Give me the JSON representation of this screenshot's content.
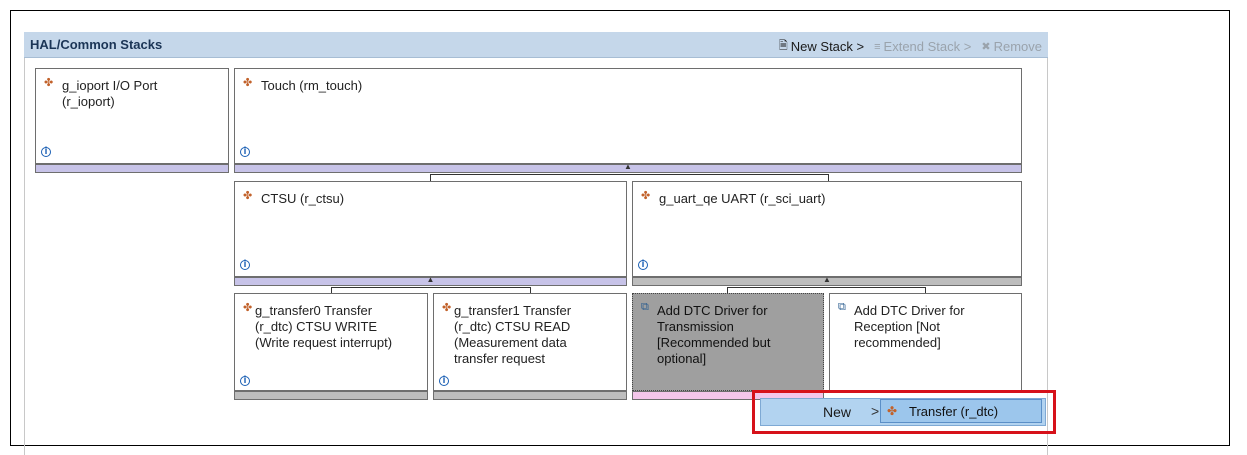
{
  "header": {
    "title": "HAL/Common Stacks",
    "new_stack": "New Stack >",
    "extend_stack": "Extend Stack >",
    "remove": "Remove"
  },
  "modules": {
    "ioport": {
      "line1": "g_ioport I/O Port",
      "line2": "(r_ioport)"
    },
    "touch": {
      "line1": "Touch (rm_touch)"
    },
    "ctsu": {
      "line1": "CTSU (r_ctsu)"
    },
    "uart": {
      "line1": "g_uart_qe UART (r_sci_uart)"
    },
    "transfer0": {
      "line1": "g_transfer0 Transfer",
      "line2": "(r_dtc) CTSU WRITE",
      "line3": "(Write request interrupt)"
    },
    "transfer1": {
      "line1": "g_transfer1 Transfer",
      "line2": "(r_dtc) CTSU READ",
      "line3": "(Measurement data",
      "line4": "transfer request"
    },
    "dtc_tx": {
      "line1": "Add DTC Driver for",
      "line2": "Transmission",
      "line3": "[Recommended but",
      "line4": "optional]"
    },
    "dtc_rx": {
      "line1": "Add DTC Driver for",
      "line2": "Reception [Not",
      "line3": "recommended]"
    }
  },
  "context_menu": {
    "new_label": "New",
    "chevron": ">",
    "submenu_item": "Transfer (r_dtc)"
  },
  "colors": {
    "header_bg": "#c5d7ea",
    "bar_purple": "#c7c3e8",
    "bar_gray": "#bdbdbd",
    "highlight_red": "#d6111a",
    "menu_bg": "#b2d3f0"
  }
}
